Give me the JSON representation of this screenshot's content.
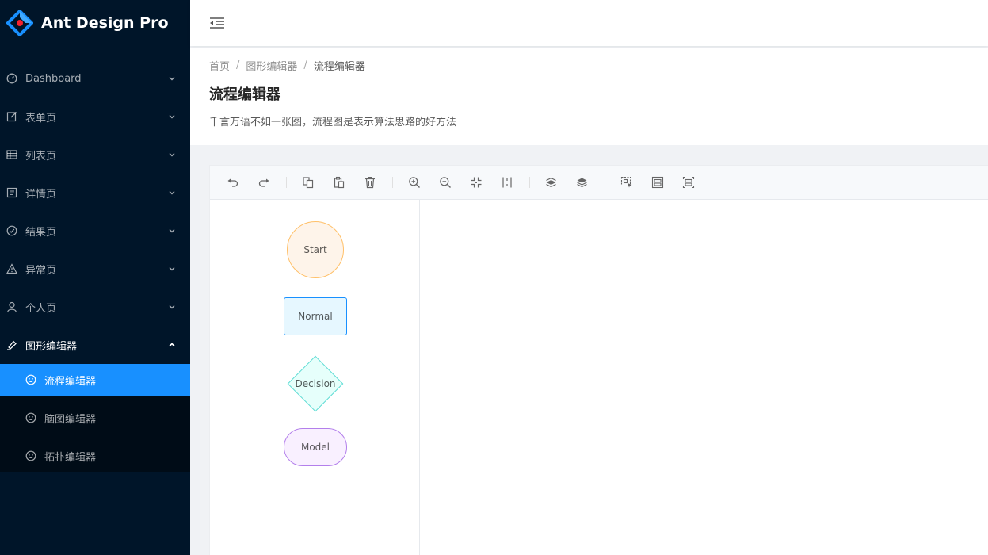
{
  "app": {
    "title": "Ant Design Pro"
  },
  "sidebar": {
    "items": [
      {
        "label": "Dashboard",
        "icon": "dashboard-icon"
      },
      {
        "label": "表单页",
        "icon": "form-icon"
      },
      {
        "label": "列表页",
        "icon": "table-icon"
      },
      {
        "label": "详情页",
        "icon": "profile-icon"
      },
      {
        "label": "结果页",
        "icon": "check-circle-icon"
      },
      {
        "label": "异常页",
        "icon": "warning-icon"
      },
      {
        "label": "个人页",
        "icon": "user-icon"
      },
      {
        "label": "图形编辑器",
        "icon": "highlight-icon"
      }
    ],
    "subitems": [
      {
        "label": "流程编辑器",
        "icon": "smile-icon"
      },
      {
        "label": "脑图编辑器",
        "icon": "smile-icon"
      },
      {
        "label": "拓扑编辑器",
        "icon": "smile-icon"
      }
    ]
  },
  "breadcrumb": {
    "home": "首页",
    "parent": "图形编辑器",
    "current": "流程编辑器"
  },
  "page": {
    "title": "流程编辑器",
    "description": "千言万语不如一张图，流程图是表示算法思路的好方法"
  },
  "toolbar": {
    "buttons": [
      "undo-icon",
      "redo-icon",
      "copy-icon",
      "paste-icon",
      "delete-icon",
      "zoom-in-icon",
      "zoom-out-icon",
      "auto-zoom-icon",
      "reset-zoom-icon",
      "to-back-icon",
      "to-front-icon",
      "multi-select-icon",
      "group-icon",
      "ungroup-icon"
    ]
  },
  "item_panel": {
    "start": "Start",
    "normal": "Normal",
    "decision": "Decision",
    "model": "Model"
  },
  "colors": {
    "sidebar_bg": "#001529",
    "submenu_bg": "#000c17",
    "primary": "#1890ff",
    "start_fill": "#fef4ea",
    "start_stroke": "#ffc069",
    "normal_fill": "#e6f7ff",
    "decision_fill": "#e6fffb",
    "decision_stroke": "#5cdbd3",
    "model_fill": "#f9f0ff",
    "model_stroke": "#b37feb"
  }
}
